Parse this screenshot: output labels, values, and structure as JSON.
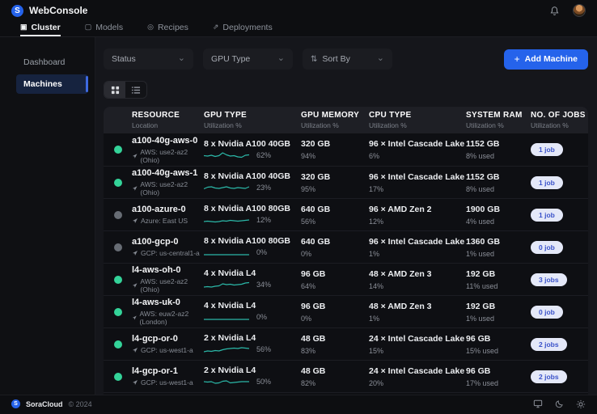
{
  "app": {
    "title": "WebConsole",
    "logo_letter": "S"
  },
  "topnav": {
    "tabs": [
      {
        "label": "Cluster",
        "icon": "cluster-icon",
        "active": true
      },
      {
        "label": "Models",
        "icon": "models-icon",
        "active": false
      },
      {
        "label": "Recipes",
        "icon": "recipes-icon",
        "active": false
      },
      {
        "label": "Deployments",
        "icon": "deployments-icon",
        "active": false
      }
    ]
  },
  "sidebar": {
    "items": [
      {
        "label": "Dashboard",
        "active": false
      },
      {
        "label": "Machines",
        "active": true
      }
    ]
  },
  "filters": {
    "dropdowns": [
      {
        "label": "Status",
        "icon": null
      },
      {
        "label": "GPU Type",
        "icon": null
      },
      {
        "label": "Sort By",
        "icon": "sort-icon"
      }
    ],
    "add_button": {
      "icon_char": "+",
      "label": "Add Machine"
    }
  },
  "view_toggle": {
    "active": "grid"
  },
  "table": {
    "columns": [
      {
        "title": "RESOURCE",
        "sub": "Location"
      },
      {
        "title": "GPU TYPE",
        "sub": "Utilization %"
      },
      {
        "title": "GPU MEMORY",
        "sub": "Utilization %"
      },
      {
        "title": "CPU TYPE",
        "sub": "Utilization %"
      },
      {
        "title": "SYSTEM RAM",
        "sub": "Utilization %"
      },
      {
        "title": "NO. OF JOBS",
        "sub": "Utilization %"
      }
    ],
    "rows": [
      {
        "name": "a100-40g-aws-0",
        "status": "online",
        "location": "AWS: use2-az2 (Ohio)",
        "gpu_type": "8 x Nvidia A100 40GB",
        "gpu_util": "62%",
        "gpu_mem": "320 GB",
        "gpu_mem_util": "94%",
        "cpu_type": "96 × Intel Cascade Lake",
        "cpu_util": "6%",
        "ram": "1152 GB",
        "ram_used": "8% used",
        "jobs": "1 job",
        "spark": [
          0.45,
          0.4,
          0.5,
          0.35,
          0.45,
          0.8,
          0.55,
          0.4,
          0.45,
          0.3,
          0.25,
          0.5,
          0.55
        ]
      },
      {
        "name": "a100-40g-aws-1",
        "status": "online",
        "location": "AWS: use2-az2 (Ohio)",
        "gpu_type": "8 x Nvidia A100 40GB",
        "gpu_util": "23%",
        "gpu_mem": "320 GB",
        "gpu_mem_util": "95%",
        "cpu_type": "96 × Intel Cascade Lake",
        "cpu_util": "17%",
        "ram": "1152 GB",
        "ram_used": "8% used",
        "jobs": "1 job",
        "spark": [
          0.35,
          0.55,
          0.6,
          0.45,
          0.4,
          0.5,
          0.6,
          0.45,
          0.4,
          0.5,
          0.45,
          0.4,
          0.6
        ]
      },
      {
        "name": "a100-azure-0",
        "status": "idle",
        "location": "Azure: East US",
        "gpu_type": "8 x Nvidia A100 80GB",
        "gpu_util": "12%",
        "gpu_mem": "640 GB",
        "gpu_mem_util": "56%",
        "cpu_type": "96 × AMD Zen 2",
        "cpu_util": "12%",
        "ram": "1900 GB",
        "ram_used": "4% used",
        "jobs": "1 job",
        "spark": [
          0.3,
          0.35,
          0.3,
          0.25,
          0.3,
          0.4,
          0.35,
          0.45,
          0.4,
          0.35,
          0.4,
          0.45,
          0.5
        ]
      },
      {
        "name": "a100-gcp-0",
        "status": "idle",
        "location": "GCP: us-central1-a",
        "gpu_type": "8 x Nvidia A100 80GB",
        "gpu_util": "0%",
        "gpu_mem": "640 GB",
        "gpu_mem_util": "0%",
        "cpu_type": "96 × Intel Cascade Lake",
        "cpu_util": "1%",
        "ram": "1360 GB",
        "ram_used": "1% used",
        "jobs": "0 job",
        "spark": [
          0.2,
          0.2,
          0.2,
          0.2,
          0.2,
          0.2,
          0.2,
          0.2,
          0.2,
          0.2,
          0.2,
          0.2,
          0.2
        ]
      },
      {
        "name": "l4-aws-oh-0",
        "status": "online",
        "location": "AWS: use2-az2 (Ohio)",
        "gpu_type": "4 x Nvidia L4",
        "gpu_util": "34%",
        "gpu_mem": "96 GB",
        "gpu_mem_util": "64%",
        "cpu_type": "48 × AMD Zen 3",
        "cpu_util": "14%",
        "ram": "192 GB",
        "ram_used": "11% used",
        "jobs": "3 jobs",
        "spark": [
          0.2,
          0.25,
          0.2,
          0.3,
          0.35,
          0.6,
          0.5,
          0.55,
          0.45,
          0.5,
          0.55,
          0.7,
          0.75
        ]
      },
      {
        "name": "l4-aws-uk-0",
        "status": "online",
        "location": "AWS: euw2-az2 (London)",
        "gpu_type": "4 x Nvidia L4",
        "gpu_util": "0%",
        "gpu_mem": "96 GB",
        "gpu_mem_util": "0%",
        "cpu_type": "48 × AMD Zen 3",
        "cpu_util": "1%",
        "ram": "192 GB",
        "ram_used": "1% used",
        "jobs": "0 job",
        "spark": [
          0.2,
          0.2,
          0.2,
          0.2,
          0.2,
          0.2,
          0.2,
          0.2,
          0.2,
          0.2,
          0.2,
          0.2,
          0.2
        ]
      },
      {
        "name": "l4-gcp-or-0",
        "status": "online",
        "location": "GCP: us-west1-a",
        "gpu_type": "2 x Nvidia L4",
        "gpu_util": "56%",
        "gpu_mem": "48 GB",
        "gpu_mem_util": "83%",
        "cpu_type": "24 × Intel Cascade Lake",
        "cpu_util": "15%",
        "ram": "96 GB",
        "ram_used": "15% used",
        "jobs": "2 jobs",
        "spark": [
          0.2,
          0.3,
          0.25,
          0.35,
          0.3,
          0.45,
          0.55,
          0.6,
          0.65,
          0.6,
          0.7,
          0.65,
          0.6
        ]
      },
      {
        "name": "l4-gcp-or-1",
        "status": "online",
        "location": "GCP: us-west1-a",
        "gpu_type": "2 x Nvidia L4",
        "gpu_util": "50%",
        "gpu_mem": "48 GB",
        "gpu_mem_util": "82%",
        "cpu_type": "24 × Intel Cascade Lake",
        "cpu_util": "20%",
        "ram": "96 GB",
        "ram_used": "17% used",
        "jobs": "2 jobs",
        "spark": [
          0.5,
          0.45,
          0.5,
          0.3,
          0.35,
          0.55,
          0.6,
          0.35,
          0.4,
          0.45,
          0.5,
          0.5,
          0.5
        ]
      }
    ]
  },
  "footer": {
    "brand": "SoraCloud",
    "copyright": "© 2024",
    "icons": [
      "display-icon",
      "moon-icon",
      "sun-icon"
    ]
  },
  "colors": {
    "accent": "#2563eb",
    "spark": "#2bb8a8",
    "status": {
      "online": "#34d399",
      "idle": "#676c74"
    },
    "badge_bg": "#e4e8f8",
    "badge_text": "#3a52c9"
  }
}
